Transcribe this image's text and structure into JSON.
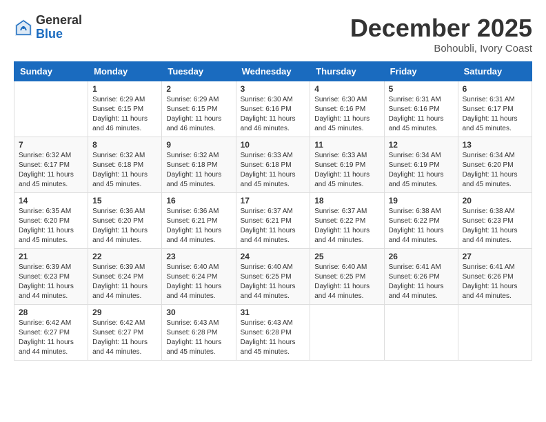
{
  "logo": {
    "general": "General",
    "blue": "Blue"
  },
  "title": "December 2025",
  "location": "Bohoubli, Ivory Coast",
  "days_of_week": [
    "Sunday",
    "Monday",
    "Tuesday",
    "Wednesday",
    "Thursday",
    "Friday",
    "Saturday"
  ],
  "weeks": [
    [
      {
        "day": "",
        "sunrise": "",
        "sunset": "",
        "daylight": ""
      },
      {
        "day": "1",
        "sunrise": "Sunrise: 6:29 AM",
        "sunset": "Sunset: 6:15 PM",
        "daylight": "Daylight: 11 hours and 46 minutes."
      },
      {
        "day": "2",
        "sunrise": "Sunrise: 6:29 AM",
        "sunset": "Sunset: 6:15 PM",
        "daylight": "Daylight: 11 hours and 46 minutes."
      },
      {
        "day": "3",
        "sunrise": "Sunrise: 6:30 AM",
        "sunset": "Sunset: 6:16 PM",
        "daylight": "Daylight: 11 hours and 46 minutes."
      },
      {
        "day": "4",
        "sunrise": "Sunrise: 6:30 AM",
        "sunset": "Sunset: 6:16 PM",
        "daylight": "Daylight: 11 hours and 45 minutes."
      },
      {
        "day": "5",
        "sunrise": "Sunrise: 6:31 AM",
        "sunset": "Sunset: 6:16 PM",
        "daylight": "Daylight: 11 hours and 45 minutes."
      },
      {
        "day": "6",
        "sunrise": "Sunrise: 6:31 AM",
        "sunset": "Sunset: 6:17 PM",
        "daylight": "Daylight: 11 hours and 45 minutes."
      }
    ],
    [
      {
        "day": "7",
        "sunrise": "Sunrise: 6:32 AM",
        "sunset": "Sunset: 6:17 PM",
        "daylight": "Daylight: 11 hours and 45 minutes."
      },
      {
        "day": "8",
        "sunrise": "Sunrise: 6:32 AM",
        "sunset": "Sunset: 6:18 PM",
        "daylight": "Daylight: 11 hours and 45 minutes."
      },
      {
        "day": "9",
        "sunrise": "Sunrise: 6:32 AM",
        "sunset": "Sunset: 6:18 PM",
        "daylight": "Daylight: 11 hours and 45 minutes."
      },
      {
        "day": "10",
        "sunrise": "Sunrise: 6:33 AM",
        "sunset": "Sunset: 6:18 PM",
        "daylight": "Daylight: 11 hours and 45 minutes."
      },
      {
        "day": "11",
        "sunrise": "Sunrise: 6:33 AM",
        "sunset": "Sunset: 6:19 PM",
        "daylight": "Daylight: 11 hours and 45 minutes."
      },
      {
        "day": "12",
        "sunrise": "Sunrise: 6:34 AM",
        "sunset": "Sunset: 6:19 PM",
        "daylight": "Daylight: 11 hours and 45 minutes."
      },
      {
        "day": "13",
        "sunrise": "Sunrise: 6:34 AM",
        "sunset": "Sunset: 6:20 PM",
        "daylight": "Daylight: 11 hours and 45 minutes."
      }
    ],
    [
      {
        "day": "14",
        "sunrise": "Sunrise: 6:35 AM",
        "sunset": "Sunset: 6:20 PM",
        "daylight": "Daylight: 11 hours and 45 minutes."
      },
      {
        "day": "15",
        "sunrise": "Sunrise: 6:36 AM",
        "sunset": "Sunset: 6:20 PM",
        "daylight": "Daylight: 11 hours and 44 minutes."
      },
      {
        "day": "16",
        "sunrise": "Sunrise: 6:36 AM",
        "sunset": "Sunset: 6:21 PM",
        "daylight": "Daylight: 11 hours and 44 minutes."
      },
      {
        "day": "17",
        "sunrise": "Sunrise: 6:37 AM",
        "sunset": "Sunset: 6:21 PM",
        "daylight": "Daylight: 11 hours and 44 minutes."
      },
      {
        "day": "18",
        "sunrise": "Sunrise: 6:37 AM",
        "sunset": "Sunset: 6:22 PM",
        "daylight": "Daylight: 11 hours and 44 minutes."
      },
      {
        "day": "19",
        "sunrise": "Sunrise: 6:38 AM",
        "sunset": "Sunset: 6:22 PM",
        "daylight": "Daylight: 11 hours and 44 minutes."
      },
      {
        "day": "20",
        "sunrise": "Sunrise: 6:38 AM",
        "sunset": "Sunset: 6:23 PM",
        "daylight": "Daylight: 11 hours and 44 minutes."
      }
    ],
    [
      {
        "day": "21",
        "sunrise": "Sunrise: 6:39 AM",
        "sunset": "Sunset: 6:23 PM",
        "daylight": "Daylight: 11 hours and 44 minutes."
      },
      {
        "day": "22",
        "sunrise": "Sunrise: 6:39 AM",
        "sunset": "Sunset: 6:24 PM",
        "daylight": "Daylight: 11 hours and 44 minutes."
      },
      {
        "day": "23",
        "sunrise": "Sunrise: 6:40 AM",
        "sunset": "Sunset: 6:24 PM",
        "daylight": "Daylight: 11 hours and 44 minutes."
      },
      {
        "day": "24",
        "sunrise": "Sunrise: 6:40 AM",
        "sunset": "Sunset: 6:25 PM",
        "daylight": "Daylight: 11 hours and 44 minutes."
      },
      {
        "day": "25",
        "sunrise": "Sunrise: 6:40 AM",
        "sunset": "Sunset: 6:25 PM",
        "daylight": "Daylight: 11 hours and 44 minutes."
      },
      {
        "day": "26",
        "sunrise": "Sunrise: 6:41 AM",
        "sunset": "Sunset: 6:26 PM",
        "daylight": "Daylight: 11 hours and 44 minutes."
      },
      {
        "day": "27",
        "sunrise": "Sunrise: 6:41 AM",
        "sunset": "Sunset: 6:26 PM",
        "daylight": "Daylight: 11 hours and 44 minutes."
      }
    ],
    [
      {
        "day": "28",
        "sunrise": "Sunrise: 6:42 AM",
        "sunset": "Sunset: 6:27 PM",
        "daylight": "Daylight: 11 hours and 44 minutes."
      },
      {
        "day": "29",
        "sunrise": "Sunrise: 6:42 AM",
        "sunset": "Sunset: 6:27 PM",
        "daylight": "Daylight: 11 hours and 44 minutes."
      },
      {
        "day": "30",
        "sunrise": "Sunrise: 6:43 AM",
        "sunset": "Sunset: 6:28 PM",
        "daylight": "Daylight: 11 hours and 45 minutes."
      },
      {
        "day": "31",
        "sunrise": "Sunrise: 6:43 AM",
        "sunset": "Sunset: 6:28 PM",
        "daylight": "Daylight: 11 hours and 45 minutes."
      },
      {
        "day": "",
        "sunrise": "",
        "sunset": "",
        "daylight": ""
      },
      {
        "day": "",
        "sunrise": "",
        "sunset": "",
        "daylight": ""
      },
      {
        "day": "",
        "sunrise": "",
        "sunset": "",
        "daylight": ""
      }
    ]
  ]
}
